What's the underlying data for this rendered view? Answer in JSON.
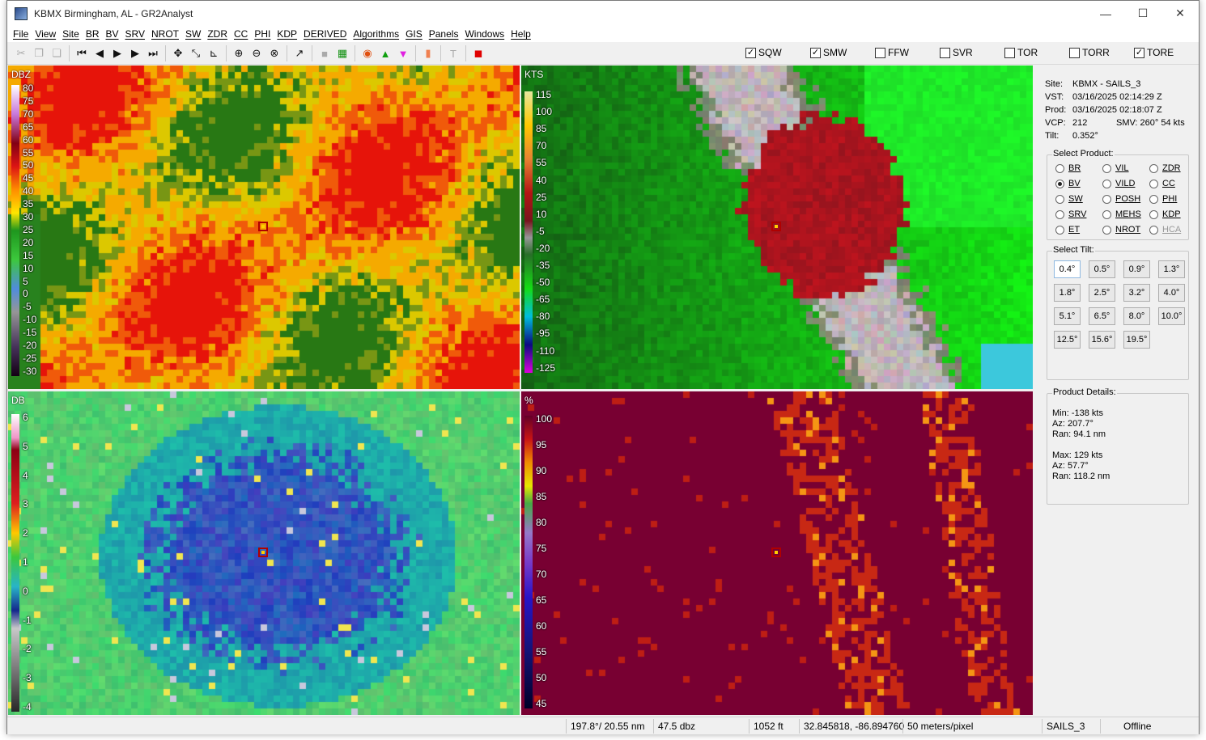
{
  "window": {
    "title": "KBMX Birmingham, AL - GR2Analyst",
    "minimize": "—",
    "maximize": "☐",
    "close": "✕"
  },
  "menu": [
    "File",
    "View",
    "Site",
    "BR",
    "BV",
    "SRV",
    "NROT",
    "SW",
    "ZDR",
    "CC",
    "PHI",
    "KDP",
    "DERIVED",
    "Algorithms",
    "GIS",
    "Panels",
    "Windows",
    "Help"
  ],
  "toolbar": {
    "icons": [
      "cut-icon",
      "copy-icon",
      "paste-icon",
      "sep",
      "first-frame-icon",
      "prev-frame-icon",
      "play-icon",
      "next-frame-icon",
      "last-frame-icon",
      "sep",
      "pan-icon",
      "resize-icon",
      "measure-icon",
      "sep",
      "zoom-in-icon",
      "zoom-out-icon",
      "zoom-reset-icon",
      "sep",
      "pick-icon",
      "sep",
      "stop-icon",
      "grid-icon",
      "sep",
      "storm-icon",
      "triangle-up-icon",
      "triangle-down-icon",
      "sep",
      "marker-icon",
      "sep",
      "text-icon",
      "sep",
      "record-icon"
    ],
    "glyphs": {
      "cut-icon": "✂",
      "copy-icon": "❐",
      "paste-icon": "❏",
      "first-frame-icon": "⏮",
      "prev-frame-icon": "◀",
      "play-icon": "▶",
      "next-frame-icon": "▶",
      "last-frame-icon": "⏭",
      "pan-icon": "✥",
      "resize-icon": "⤡",
      "measure-icon": "⊾",
      "zoom-in-icon": "⊕",
      "zoom-out-icon": "⊖",
      "zoom-reset-icon": "⊗",
      "pick-icon": "↗",
      "stop-icon": "■",
      "grid-icon": "▦",
      "storm-icon": "◉",
      "triangle-up-icon": "▲",
      "triangle-down-icon": "▼",
      "marker-icon": "▮",
      "text-icon": "T",
      "record-icon": "◼"
    },
    "colors": {
      "triangle-up-icon": "#10a010",
      "triangle-down-icon": "#e020e0",
      "storm-icon": "#e05010",
      "marker-icon": "#f08050",
      "record-icon": "#e00000",
      "grid-icon": "#109010"
    }
  },
  "warnings": [
    {
      "label": "SQW",
      "checked": true
    },
    {
      "label": "SMW",
      "checked": true
    },
    {
      "label": "FFW",
      "checked": false
    },
    {
      "label": "SVR",
      "checked": false
    },
    {
      "label": "TOR",
      "checked": false
    },
    {
      "label": "TORR",
      "checked": false
    },
    {
      "label": "TORE",
      "checked": true
    }
  ],
  "panels": {
    "reflectivity": {
      "units": "DBZ",
      "scale": [
        "80",
        "75",
        "70",
        "65",
        "60",
        "55",
        "50",
        "45",
        "40",
        "35",
        "30",
        "25",
        "20",
        "15",
        "10",
        "5",
        "0",
        "-5",
        "-10",
        "-15",
        "-20",
        "-25",
        "-30"
      ]
    },
    "velocity": {
      "units": "KTS",
      "scale": [
        "115",
        "100",
        "85",
        "70",
        "55",
        "40",
        "25",
        "10",
        "-5",
        "-20",
        "-35",
        "-50",
        "-65",
        "-80",
        "-95",
        "-110",
        "-125"
      ]
    },
    "zdr": {
      "units": "DB",
      "scale": [
        "6",
        "5",
        "4",
        "3",
        "2",
        "1",
        "0",
        "-1",
        "-2",
        "-3",
        "-4"
      ]
    },
    "cc": {
      "units": "%",
      "scale": [
        "100",
        "95",
        "90",
        "85",
        "80",
        "75",
        "70",
        "65",
        "60",
        "55",
        "50",
        "45"
      ]
    }
  },
  "info": {
    "site_k": "Site:",
    "site_v": "KBMX - SAILS_3",
    "vst_k": "VST:",
    "vst_v": "03/16/2025  02:14:29 Z",
    "prod_k": "Prod:",
    "prod_v": "03/16/2025  02:18:07 Z",
    "vcp_k": "VCP:",
    "vcp_v": "212",
    "smv": "SMV:  260° 54 kts",
    "tilt_k": "Tilt:",
    "tilt_v": "0.352°"
  },
  "select_product": {
    "title": "Select Product:",
    "items": [
      {
        "label": "BR",
        "selected": false,
        "enabled": true
      },
      {
        "label": "VIL",
        "selected": false,
        "enabled": true
      },
      {
        "label": "ZDR",
        "selected": false,
        "enabled": true
      },
      {
        "label": "BV",
        "selected": true,
        "enabled": true
      },
      {
        "label": "VILD",
        "selected": false,
        "enabled": true
      },
      {
        "label": "CC",
        "selected": false,
        "enabled": true
      },
      {
        "label": "SW",
        "selected": false,
        "enabled": true
      },
      {
        "label": "POSH",
        "selected": false,
        "enabled": true
      },
      {
        "label": "PHI",
        "selected": false,
        "enabled": true
      },
      {
        "label": "SRV",
        "selected": false,
        "enabled": true
      },
      {
        "label": "MEHS",
        "selected": false,
        "enabled": true
      },
      {
        "label": "KDP",
        "selected": false,
        "enabled": true
      },
      {
        "label": "ET",
        "selected": false,
        "enabled": true
      },
      {
        "label": "NROT",
        "selected": false,
        "enabled": true
      },
      {
        "label": "HCA",
        "selected": false,
        "enabled": false
      }
    ]
  },
  "select_tilt": {
    "title": "Select Tilt:",
    "items": [
      "0.4°",
      "0.5°",
      "0.9°",
      "1.3°",
      "1.8°",
      "2.5°",
      "3.2°",
      "4.0°",
      "5.1°",
      "6.5°",
      "8.0°",
      "10.0°",
      "12.5°",
      "15.6°",
      "19.5°"
    ],
    "selected": "0.4°"
  },
  "product_details": {
    "title": "Product Details:",
    "lines": [
      "Min:  -138 kts",
      "Az:   207.7°",
      "Ran:  94.1 nm",
      "",
      "Max:  129 kts",
      "Az:   57.7°",
      "Ran:  118.2 nm"
    ]
  },
  "status": {
    "azran": "197.8°/ 20.55 nm",
    "value": "47.5 dbz",
    "height": "1052 ft",
    "latlon": "32.845818, -86.894760",
    "res": "50 meters/pixel",
    "site": "SAILS_3",
    "conn": "Offline"
  }
}
